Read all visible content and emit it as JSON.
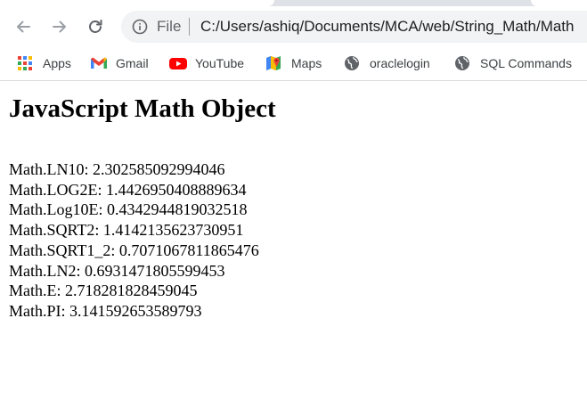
{
  "browser": {
    "address_scheme": "File",
    "address_url": "C:/Users/ashiq/Documents/MCA/web/String_Math/Math"
  },
  "bookmarks": [
    {
      "label": "Apps",
      "icon": "apps-grid-icon"
    },
    {
      "label": "Gmail",
      "icon": "gmail-icon"
    },
    {
      "label": "YouTube",
      "icon": "youtube-icon"
    },
    {
      "label": "Maps",
      "icon": "maps-icon"
    },
    {
      "label": "oraclelogin",
      "icon": "globe-icon"
    },
    {
      "label": "SQL Commands",
      "icon": "globe-icon"
    }
  ],
  "page": {
    "heading": "JavaScript Math Object",
    "lines": [
      "Math.LN10: 2.302585092994046",
      "Math.LOG2E: 1.4426950408889634",
      "Math.Log10E: 0.4342944819032518",
      "Math.SQRT2: 1.4142135623730951",
      "Math.SQRT1_2: 0.7071067811865476",
      "Math.LN2: 0.6931471805599453",
      "Math.E: 2.718281828459045",
      "Math.PI: 3.141592653589793"
    ]
  }
}
